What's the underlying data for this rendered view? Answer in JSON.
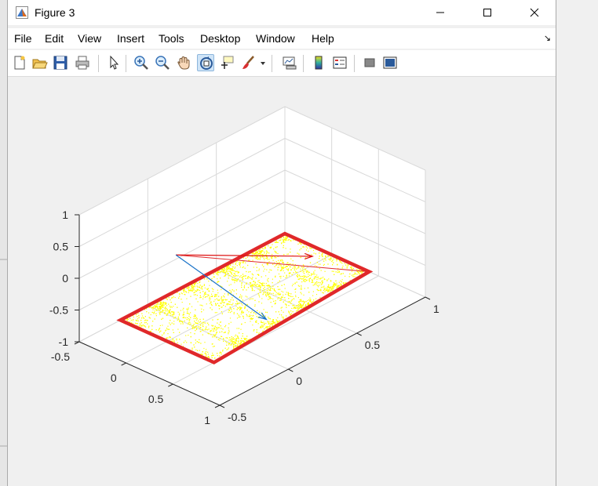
{
  "window": {
    "title": "Figure 3",
    "icons": {
      "app": "matlab-figure-icon",
      "minimize": "minimize-icon",
      "maximize": "maximize-icon",
      "close": "close-icon"
    }
  },
  "menu": {
    "items": [
      "File",
      "Edit",
      "View",
      "Insert",
      "Tools",
      "Desktop",
      "Window",
      "Help"
    ],
    "dock_icon": "dock-arrow-icon"
  },
  "toolbar": {
    "buttons": [
      "new-figure-icon",
      "open-file-icon",
      "save-icon",
      "print-icon",
      "edit-plot-icon",
      "zoom-in-icon",
      "zoom-out-icon",
      "pan-icon",
      "rotate-3d-icon",
      "data-cursor-icon",
      "brush-icon",
      "link-plot-icon",
      "colorbar-icon",
      "legend-icon",
      "hide-plot-tools-icon",
      "show-plot-tools-icon"
    ],
    "active": "rotate-3d-icon"
  },
  "colors": {
    "boundary": "#e0282a",
    "points": "#ffff00",
    "arrow_red": "#dd1111",
    "arrow_blue": "#1a73c8",
    "grid": "#d9d9d9",
    "axes_bg": "#ffffff"
  },
  "chart_data": {
    "type": "scatter3d",
    "title": "",
    "xlabel": "",
    "ylabel": "",
    "zlabel": "",
    "x_ticks": [
      "-0.5",
      "0",
      "0.5",
      "1"
    ],
    "y_ticks": [
      "-0.5",
      "0",
      "0.5",
      "1"
    ],
    "z_ticks": [
      "-1",
      "-0.5",
      "0",
      "0.5",
      "1"
    ],
    "xlim": [
      -0.5,
      1
    ],
    "ylim": [
      -0.5,
      1
    ],
    "zlim": [
      -1,
      1
    ],
    "grid": true,
    "boundary_corners": [
      [
        -0.5,
        1.0,
        -1
      ],
      [
        0.4,
        1.0,
        -1
      ],
      [
        0.5,
        -0.2,
        -1
      ],
      [
        -0.5,
        -0.2,
        -1
      ]
    ],
    "vectors": [
      {
        "color": "red",
        "from": [
          -0.2,
          0.0,
          0
        ],
        "to": [
          0.6,
          0.45,
          0
        ]
      },
      {
        "color": "blue",
        "from": [
          -0.2,
          0.0,
          0
        ],
        "to": [
          0.4,
          0.25,
          -0.9
        ]
      }
    ],
    "point_cloud_plane_z": -1,
    "point_count_visual": "dense"
  }
}
